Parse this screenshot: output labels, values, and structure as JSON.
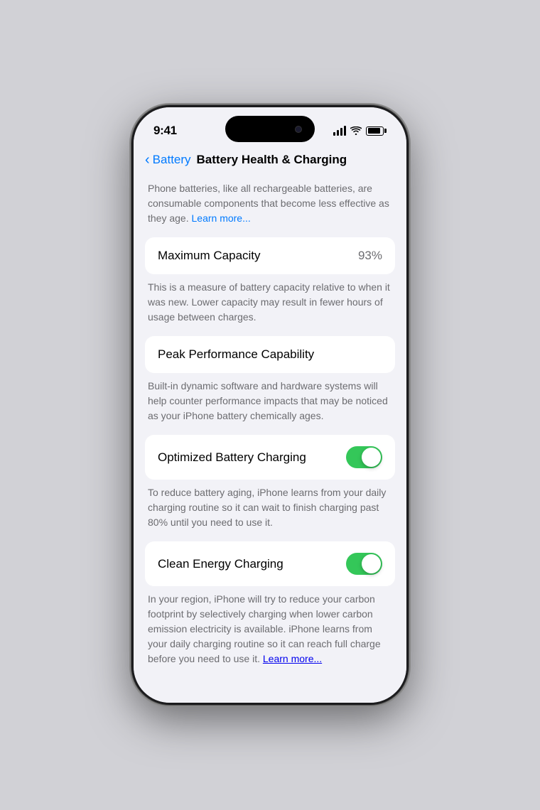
{
  "statusBar": {
    "time": "9:41",
    "icons": {
      "signal": "signal-icon",
      "wifi": "wifi-icon",
      "battery": "battery-icon"
    }
  },
  "navigation": {
    "backLabel": "Battery",
    "pageTitle": "Battery Health & Charging"
  },
  "introDescription": "Phone batteries, like all rechargeable batteries, are consumable components that become less effective as they age.",
  "learnMore1": "Learn more...",
  "maxCapacity": {
    "label": "Maximum Capacity",
    "value": "93%",
    "description": "This is a measure of battery capacity relative to when it was new. Lower capacity may result in fewer hours of usage between charges."
  },
  "peakPerformance": {
    "label": "Peak Performance Capability",
    "description": "Built-in dynamic software and hardware systems will help counter performance impacts that may be noticed as your iPhone battery chemically ages."
  },
  "optimizedCharging": {
    "label": "Optimized Battery Charging",
    "enabled": true,
    "description": "To reduce battery aging, iPhone learns from your daily charging routine so it can wait to finish charging past 80% until you need to use it."
  },
  "cleanEnergyCharging": {
    "label": "Clean Energy Charging",
    "enabled": true,
    "description": "In your region, iPhone will try to reduce your carbon footprint by selectively charging when lower carbon emission electricity is available. iPhone learns from your daily charging routine so it can reach full charge before you need to use it.",
    "learnMore": "Learn more..."
  }
}
